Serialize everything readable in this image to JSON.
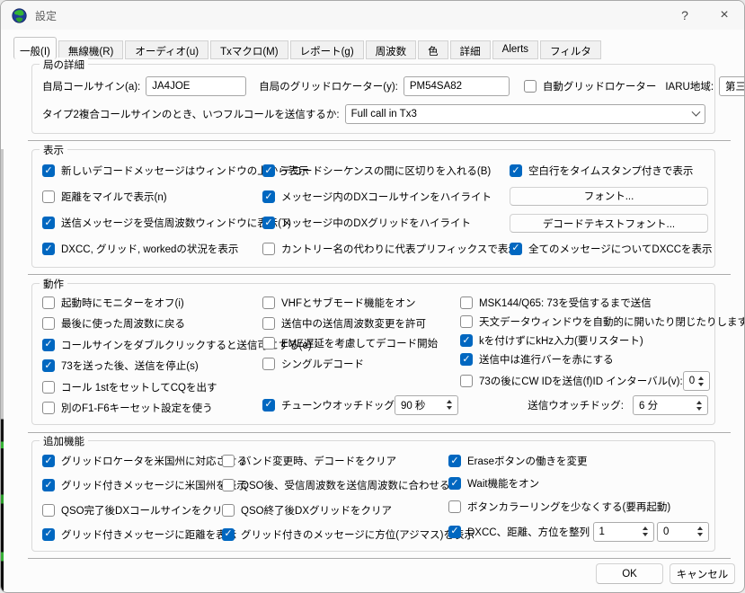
{
  "colors": {
    "accent": "#0067c0"
  },
  "window": {
    "title": "設定",
    "help_label": "?",
    "close_label": "×"
  },
  "tabs": [
    "一般(I)",
    "無線機(R)",
    "オーディオ(u)",
    "Txマクロ(M)",
    "レポート(g)",
    "周波数",
    "色",
    "詳細",
    "Alerts",
    "フィルタ"
  ],
  "station": {
    "title": "局の詳細",
    "callsign": {
      "label": "自局コールサイン(a):",
      "value": "JA4JOE"
    },
    "grid": {
      "label": "自局のグリッドロケーター(y):",
      "value": "PM54SA82"
    },
    "auto_grid": {
      "label": "自動グリッドロケーター",
      "checked": false
    },
    "iaru": {
      "label": "IARU地域:",
      "value": "第三地域"
    },
    "type2": {
      "label": "タイプ2複合コールサインのとき、いつフルコールを送信するか:",
      "value": "Full call in Tx3"
    }
  },
  "display": {
    "title": "表示",
    "col1": [
      {
        "label": "新しいデコードメッセージはウィンドウの上から表示",
        "checked": true
      },
      {
        "label": "距離をマイルで表示(n)",
        "checked": false
      },
      {
        "label": "送信メッセージを受信周波数ウィンドウに表示(T)",
        "checked": true
      },
      {
        "label": "DXCC, グリッド, workedの状況を表示",
        "checked": true
      }
    ],
    "col2": [
      {
        "label": "デコードシーケンスの間に区切りを入れる(B)",
        "checked": true
      },
      {
        "label": "メッセージ内のDXコールサインをハイライト",
        "checked": true
      },
      {
        "label": "メッセージ中のDXグリッドをハイライト",
        "checked": true
      },
      {
        "label": "カントリー名の代わりに代表プリフィックスで表示",
        "checked": false
      }
    ],
    "col3": {
      "blank_lines": {
        "label": "空白行をタイムスタンプ付きで表示",
        "checked": true
      },
      "font_button": "フォント...",
      "decode_font_button": "デコードテキストフォント...",
      "show_dxcc": {
        "label": "全てのメッセージについてDXCCを表示",
        "checked": true
      }
    }
  },
  "behavior": {
    "title": "動作",
    "col1": [
      {
        "label": "起動時にモニターをオフ(i)",
        "checked": false
      },
      {
        "label": "最後に使った周波数に戻る",
        "checked": false
      },
      {
        "label": "コールサインをダブルクリックすると送信可にする(e)",
        "checked": true
      },
      {
        "label": "73を送った後、送信を停止(s)",
        "checked": true
      },
      {
        "label": "コール 1stをセットしてCQを出す",
        "checked": false
      },
      {
        "label": "別のF1-F6キーセット設定を使う",
        "checked": false
      }
    ],
    "col2": [
      {
        "label": "VHFとサブモード機能をオン",
        "checked": false
      },
      {
        "label": "送信中の送信周波数変更を許可",
        "checked": false
      },
      {
        "label": "EME遅延を考慮してデコード開始",
        "checked": false
      },
      {
        "label": "シングルデコード",
        "checked": false
      }
    ],
    "tune_watchdog": {
      "label": "チューンウオッチドッグ",
      "checked": true,
      "value": "90 秒"
    },
    "col3": [
      {
        "label": "MSK144/Q65: 73を受信するまで送信",
        "checked": false
      },
      {
        "label": "天文データウィンドウを自動的に開いたり閉じたりします",
        "checked": false
      },
      {
        "label": "kを付けずにkHz入力(要リスタート)",
        "checked": true
      },
      {
        "label": "送信中は進行バーを赤にする",
        "checked": true
      }
    ],
    "cw_id": {
      "label": "73の後にCW IDを送信(f)",
      "checked": false
    },
    "id_interval": {
      "label": "ID インターバル(v):",
      "value": "0"
    },
    "tx_watchdog": {
      "label": "送信ウオッチドッグ:",
      "value": "6 分"
    }
  },
  "extra": {
    "title": "追加機能",
    "col1": [
      {
        "label": "グリッドロケータを米国州に対応させる",
        "checked": true
      },
      {
        "label": "グリッド付きメッセージに米国州を表示",
        "checked": true
      },
      {
        "label": "QSO完了後DXコールサインをクリア",
        "checked": false
      },
      {
        "label": "グリッド付きメッセージに距離を表示",
        "checked": true
      }
    ],
    "col2": [
      {
        "label": "バンド変更時、デコードをクリア",
        "checked": false
      },
      {
        "label": "QSO後、受信周波数を送信周波数に合わせる",
        "checked": false
      },
      {
        "label": "QSO終了後DXグリッドをクリア",
        "checked": false
      },
      {
        "label": "グリッド付きのメッセージに方位(アジマス)を表示",
        "checked": true
      }
    ],
    "col3": [
      {
        "label": "Eraseボタンの働きを変更",
        "checked": true
      },
      {
        "label": "Wait機能をオン",
        "checked": true
      },
      {
        "label": "ボタンカラーリングを少なくする(要再起動)",
        "checked": false
      }
    ],
    "align": {
      "label": "DXCC、距離、方位を整列",
      "checked": true,
      "value1": "1",
      "value2": "0"
    }
  },
  "footer": {
    "ok": "OK",
    "cancel": "キャンセル"
  }
}
